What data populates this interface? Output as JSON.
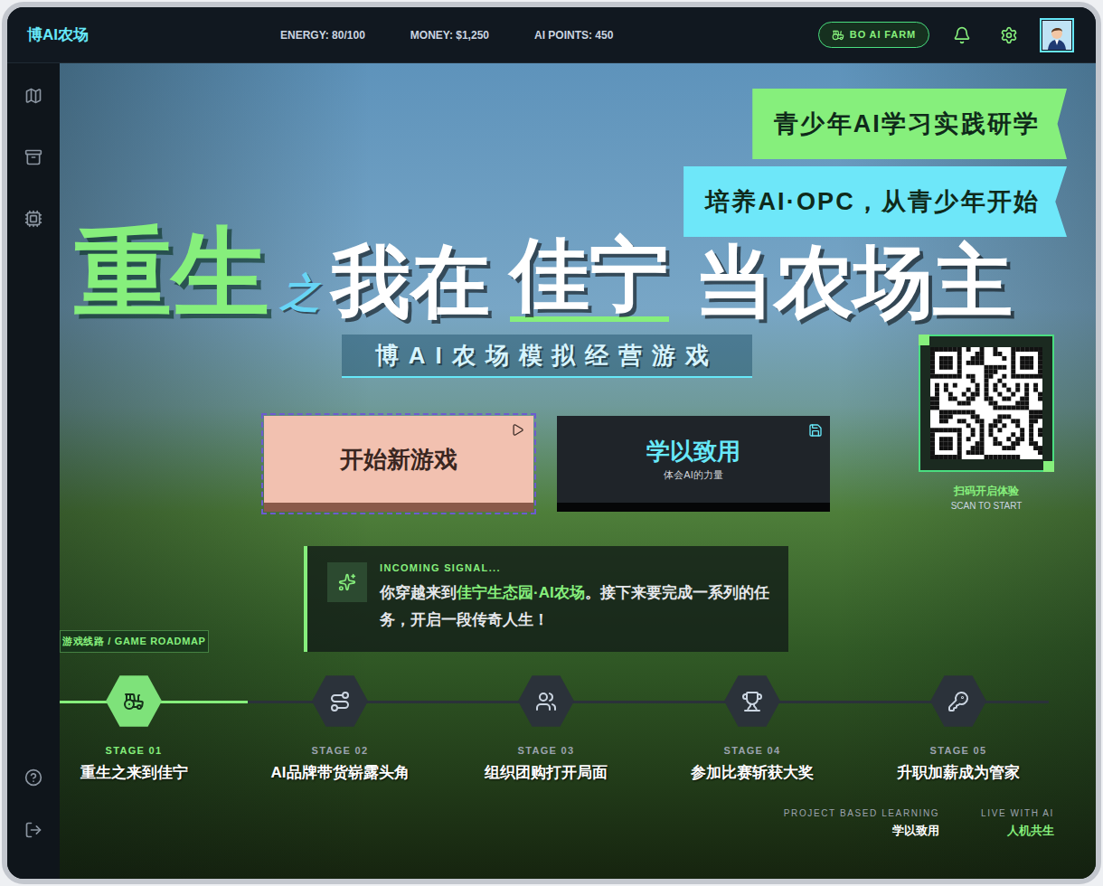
{
  "app": {
    "logo": "博AI农场"
  },
  "stats": [
    {
      "text": "ENERGY: 80/100"
    },
    {
      "text": "MONEY: $1,250"
    },
    {
      "text": "AI POINTS: 450"
    }
  ],
  "farm_button": {
    "label": "BO AI FARM"
  },
  "banners": [
    {
      "text": "青少年AI学习实践研学",
      "color": "#86ef7c"
    },
    {
      "text": "培养AI·OPC，从青少年开始",
      "color": "#6ee7f9"
    }
  ],
  "title": {
    "parts": [
      {
        "text": "重生",
        "kind": "accent"
      },
      {
        "text": "之",
        "kind": "small"
      },
      {
        "text": "我在",
        "kind": "plain"
      },
      {
        "text": "佳宁",
        "kind": "underline"
      },
      {
        "text": "当农场主",
        "kind": "plain"
      }
    ]
  },
  "subtitle": "博AI农场模拟经营游戏",
  "buttons": [
    {
      "label": "开始新游戏",
      "kind": "primary",
      "focused": true
    },
    {
      "label": "学以致用",
      "sub": "体会AI的力量",
      "kind": "secondary",
      "focused": false
    }
  ],
  "qr": {
    "caption": "扫码开启体验",
    "sub": "SCAN TO START"
  },
  "signal": {
    "heading": "INCOMING SIGNAL...",
    "parts": [
      {
        "text": "你穿越来到",
        "highlight": false
      },
      {
        "text": "佳宁生态园·AI农场",
        "highlight": true
      },
      {
        "text": "。接下来要完成一系列的任务，开启一段传奇人生！",
        "highlight": false
      }
    ]
  },
  "roadmap": {
    "label": "游戏线路 / GAME ROADMAP",
    "level": 0.19,
    "stages": [
      {
        "label": "STAGE 01",
        "title": "重生之来到佳宁",
        "selected": true
      },
      {
        "label": "STAGE 02",
        "title": "AI品牌带货崭露头角",
        "selected": false
      },
      {
        "label": "STAGE 03",
        "title": "组织团购打开局面",
        "selected": false
      },
      {
        "label": "STAGE 04",
        "title": "参加比赛斩获大奖",
        "selected": false
      },
      {
        "label": "STAGE 05",
        "title": "升职加薪成为管家",
        "selected": false
      }
    ]
  },
  "footer": [
    {
      "label": "PROJECT BASED LEARNING",
      "value": "学以致用",
      "color": "#ffffff"
    },
    {
      "label": "LIVE WITH AI",
      "value": "人机共生",
      "color": "#86ef7c"
    }
  ]
}
